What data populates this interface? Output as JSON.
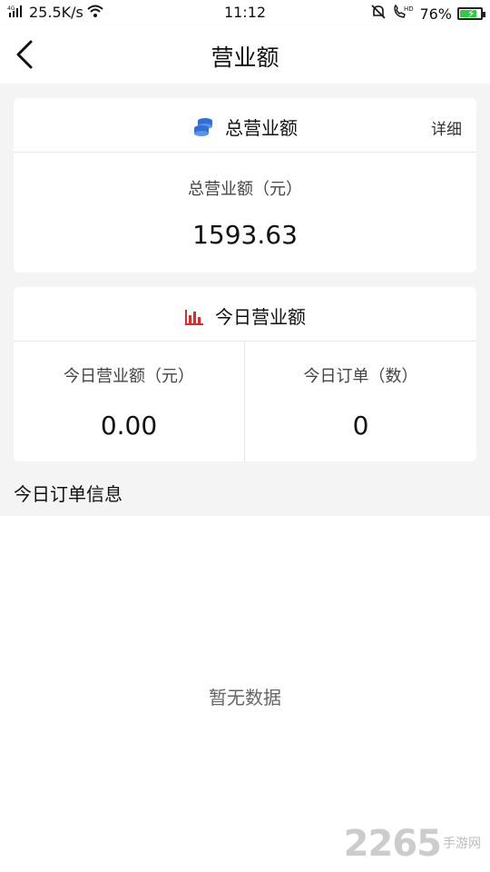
{
  "status_bar": {
    "network": "4G",
    "speed": "25.5K/s",
    "time": "11:12",
    "hd": "HD",
    "battery": "76%",
    "battery_level": 0.76
  },
  "nav": {
    "title": "营业额"
  },
  "total_card": {
    "title": "总营业额",
    "detail": "详细",
    "label": "总营业额（元）",
    "value": "1593.63"
  },
  "today_card": {
    "title": "今日营业额",
    "revenue_label": "今日营业额（元）",
    "revenue_value": "0.00",
    "orders_label": "今日订单（数）",
    "orders_value": "0"
  },
  "orders_section": {
    "title": "今日订单信息",
    "empty_text": "暂无数据"
  },
  "watermark": {
    "number": "2265",
    "text": "手游网"
  },
  "colors": {
    "coins_icon": "#2f6fd6",
    "chart_icon": "#e02a2a",
    "background": "#f4f4f4"
  }
}
